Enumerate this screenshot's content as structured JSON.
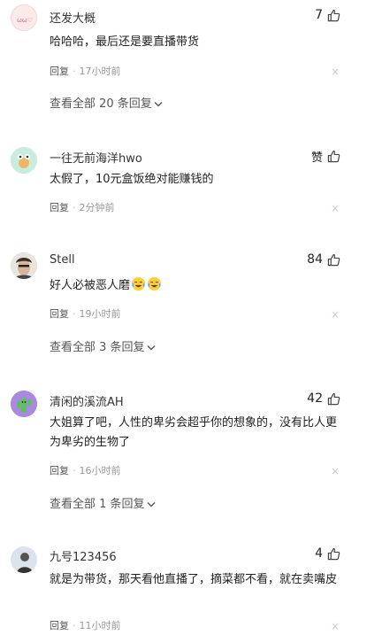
{
  "comments": [
    {
      "username": "还发大概",
      "likes": "7",
      "text": "哈哈哈，最后还是要直播带货",
      "reply": "回复",
      "time": "17小时前",
      "view_all": "查看全部 20 条回复"
    },
    {
      "username": "一往无前海洋hwo",
      "likes": "赞",
      "text": "太假了，10元盒饭绝对能赚钱的",
      "reply": "回复",
      "time": "2分钟前"
    },
    {
      "username": "Stell",
      "likes": "84",
      "text": "好人必被恶人磨",
      "emoji": "crying-laughing-emoji",
      "reply": "回复",
      "time": "19小时前",
      "view_all": "查看全部 3 条回复"
    },
    {
      "username": "清闲的溪流AH",
      "likes": "42",
      "text": "大姐算了吧，人性的卑劣会超乎你的想象的，没有比人更为卑劣的生物了",
      "reply": "回复",
      "time": "16小时前",
      "view_all": "查看全部 1 条回复"
    },
    {
      "username": "九号123456",
      "likes": "4",
      "text": "就是为带货，那天看他直播了，摘菜都不看，就在卖嘴皮",
      "reply": "回复",
      "time": "11小时前"
    }
  ],
  "separator": "·",
  "close_glyph": "×",
  "icons": {
    "like": "thumbs-up-icon",
    "chevron": "chevron-down-icon"
  }
}
